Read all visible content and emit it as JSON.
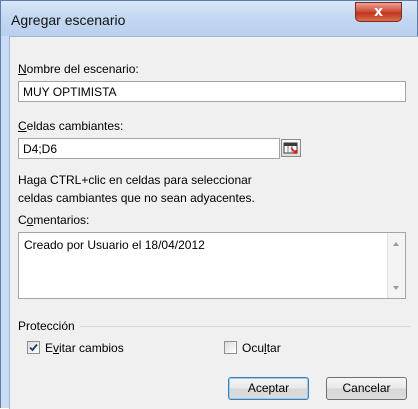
{
  "window": {
    "title": "Agregar escenario",
    "close_glyph": "x"
  },
  "scenario_name": {
    "label_hotkey": "N",
    "label_rest": "ombre del escenario:",
    "value": "MUY OPTIMISTA"
  },
  "changing_cells": {
    "label_hotkey": "C",
    "label_rest": "eldas cambiantes:",
    "value": "D4;D6",
    "picker_icon": "range-selector-icon"
  },
  "hint": {
    "line1": "Haga CTRL+clic en celdas para seleccionar",
    "line2": "celdas cambiantes que no sean adyacentes."
  },
  "comments": {
    "label_before": "C",
    "label_hotkey": "o",
    "label_rest": "mentarios:",
    "value": "Creado por Usuario el 18/04/2012"
  },
  "protection": {
    "heading": "Protección",
    "prevent_changes": {
      "label_before": "E",
      "label_hotkey": "v",
      "label_rest": "itar cambios",
      "checked": true
    },
    "hide": {
      "label_before": "Ocu",
      "label_hotkey": "l",
      "label_rest": "tar",
      "checked": false
    }
  },
  "buttons": {
    "ok": "Aceptar",
    "cancel": "Cancelar"
  },
  "colors": {
    "titlebar": "#c5d9f2",
    "close_button": "#c1341c",
    "client_bg": "#f0f0f0",
    "default_button_border": "#3c7fb1"
  }
}
